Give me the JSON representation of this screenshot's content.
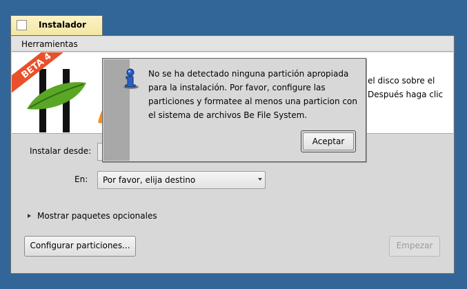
{
  "window": {
    "title": "Instalador"
  },
  "menubar": {
    "tools": "Herramientas"
  },
  "banner": {
    "badge": "BETA 4",
    "instruction": "el disco sobre el Después haga clic"
  },
  "form": {
    "install_from_label": "Instalar desde:",
    "destination_label": "En:",
    "destination_value": "Por favor, elija destino",
    "optional_packages": "Mostrar paquetes opcionales",
    "partitions_button": "Configurar particiones...",
    "start_button": "Empezar"
  },
  "alert": {
    "icon": "info-icon",
    "message": "No se ha detectado ninguna partición apropiada para la instalación. Por favor, configure las particiones y formatee al menos una particion con el sistema de archivos Be File System.",
    "accept_button": "Aceptar"
  },
  "colors": {
    "desktop": "#336698",
    "tab": "#f3e6a1",
    "panel": "#d8d8d8",
    "badge": "#e8512a"
  }
}
